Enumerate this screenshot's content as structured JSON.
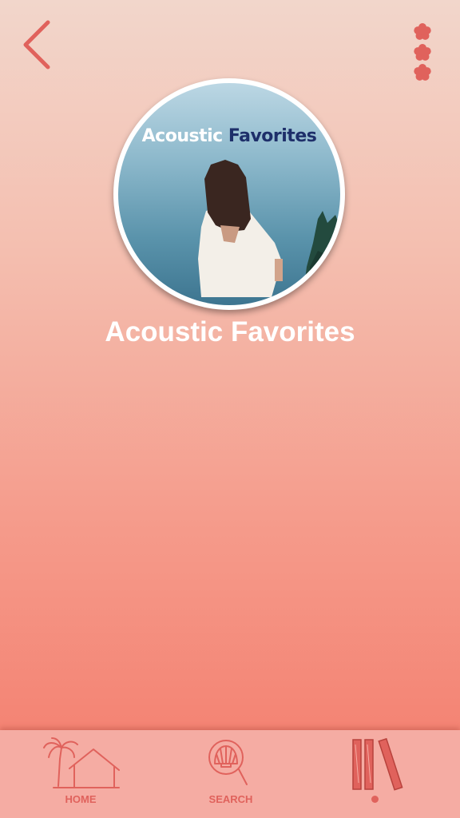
{
  "header": {
    "back_icon": "chevron-left-icon",
    "more_icon": "flower-dots-icon"
  },
  "playlist": {
    "cover_title_word1": "Acoustic",
    "cover_title_word2": "Favorites",
    "title": "Acoustic Favorites"
  },
  "nav": {
    "items": [
      {
        "label": "HOME",
        "icon": "palm-house-icon"
      },
      {
        "label": "SEARCH",
        "icon": "shell-magnifier-icon"
      },
      {
        "label": "",
        "icon": "library-icon",
        "active": true
      }
    ]
  },
  "colors": {
    "accent": "#e0625c",
    "nav_bg": "#f5aca3",
    "gradient_top": "#f2d6cb",
    "gradient_bottom": "#f47a6a",
    "cover_title_dark": "#1e2f6a"
  }
}
